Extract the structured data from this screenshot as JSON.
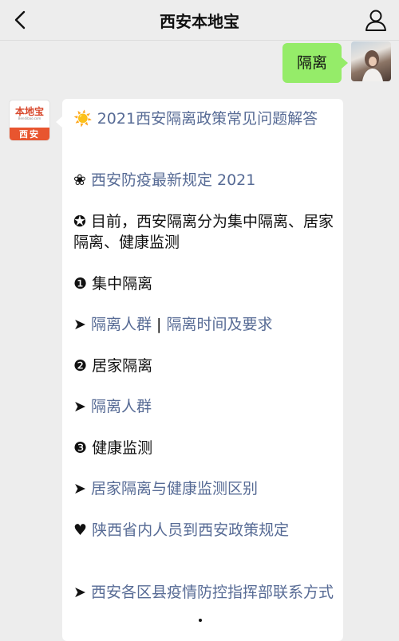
{
  "header": {
    "title": "西安本地宝",
    "back_icon": "chevron-left-icon",
    "profile_icon": "person-icon"
  },
  "outgoing": {
    "text": "隔离"
  },
  "account_avatar": {
    "logo": "本地宝",
    "url": "Bendibao.com",
    "city": "西安"
  },
  "colors": {
    "outgoing_bubble": "#95ec69",
    "link": "#576b95",
    "account_accent": "#e8552f"
  },
  "reply": {
    "item1_icon": "☀️",
    "item1_text": "2021西安隔离政策常见问题解答",
    "item2_icon": "❀",
    "item2_text": "西安防疫最新规定 2021",
    "intro_icon": "✪",
    "intro_text": "目前，西安隔离分为集中隔离、居家隔离、健康监测",
    "sec1_num": "❶",
    "sec1_title": "集中隔离",
    "sec1_arrow": "➤",
    "sec1_link1": "隔离人群",
    "sec1_sep": "|",
    "sec1_link2": "隔离时间及要求",
    "sec2_num": "❷",
    "sec2_title": "居家隔离",
    "sec2_arrow": "➤",
    "sec2_link": "隔离人群",
    "sec3_num": "❸",
    "sec3_title": "健康监测",
    "sec3_arrow": "➤",
    "sec3_link": "居家隔离与健康监测区别",
    "heart_icon": "♥",
    "heart_link": "陕西省内人员到西安政策规定",
    "last_arrow": "➤",
    "last_link": "西安各区县疫情防控指挥部联系方式"
  }
}
